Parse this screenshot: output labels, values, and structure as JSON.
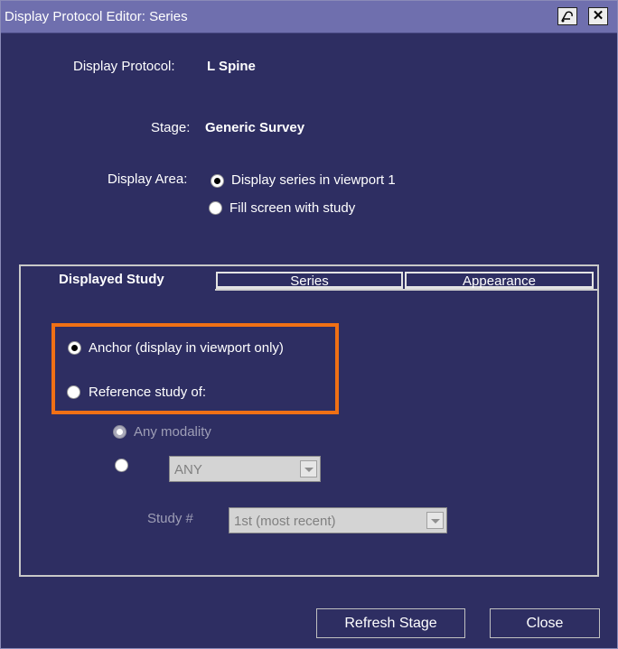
{
  "window": {
    "title": "Display Protocol Editor: Series"
  },
  "titlebar": {
    "help_icon": "help-pointer-icon",
    "close_icon": "close-icon",
    "close_glyph": "✕"
  },
  "form": {
    "protocol_label": "Display Protocol:",
    "protocol_value": "L Spine",
    "stage_label": "Stage:",
    "stage_value": "Generic Survey",
    "area_label": "Display Area:",
    "area_options": [
      {
        "label": "Display series in viewport 1",
        "selected": true
      },
      {
        "label": "Fill screen with study",
        "selected": false
      }
    ]
  },
  "tabs": [
    {
      "label": "Displayed Study",
      "active": true
    },
    {
      "label": "Series",
      "active": false
    },
    {
      "label": "Appearance",
      "active": false
    }
  ],
  "displayed_study": {
    "anchor_label": "Anchor (display in viewport only)",
    "anchor_selected": true,
    "reference_label": "Reference study of:",
    "reference_selected": false,
    "any_modality_label": "Any modality",
    "modality_select_value": "ANY",
    "study_num_label": "Study #",
    "study_num_value": "1st (most recent)"
  },
  "buttons": {
    "refresh": "Refresh Stage",
    "close": "Close"
  },
  "colors": {
    "background": "#2e2e62",
    "titlebar": "#6f6fae",
    "highlight": "#f07015"
  }
}
